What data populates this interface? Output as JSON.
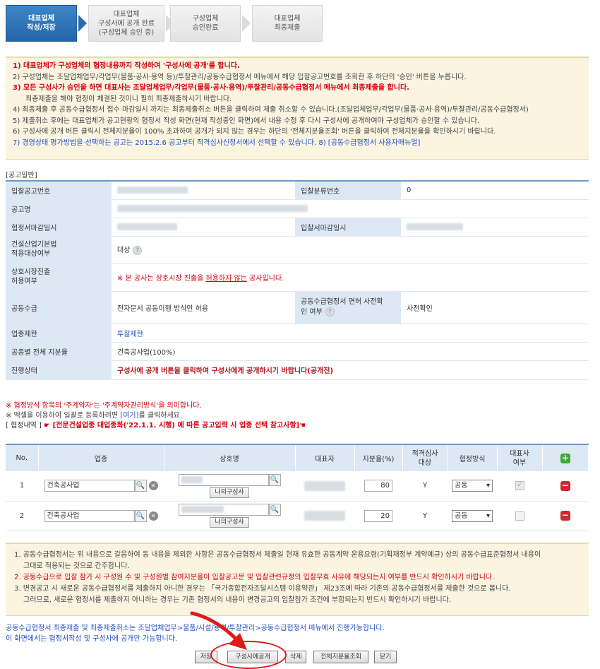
{
  "steps": [
    {
      "lines": [
        "대표업체",
        "작성/저장"
      ]
    },
    {
      "lines": [
        "대표업체",
        "구성사에 공개 완료",
        "(구성업체 승인 중)"
      ]
    },
    {
      "lines": [
        "구성업체",
        "승인완료"
      ]
    },
    {
      "lines": [
        "대표업체",
        "최종제출"
      ]
    }
  ],
  "notice": {
    "l1": "1) 대표업체가 구성업체의 협정내용까지 작성하여 '구성사에 공개'를 합니다.",
    "l2": "2) 구성업체는 조달업체업무/각업무(물품·공사·용역 등)/투찰관리/공동수급협정서 메뉴에서 해당 입찰공고번호를 조회한 후 하단의 '승인' 버튼을 누릅니다.",
    "l3": "3) 모든 구성사가 승인을 하면 대표사는 조달업체업무/각업무(물품·공사·용역)/투찰관리/공동수급협정서 메뉴에서 최종제출을 합니다.",
    "l3b": "최종제출을 해야 협정이 체결된 것이니 필히 최종제출하시기 바랍니다.",
    "l4": "4) 최종제출 후 공동수급협정서 접수 마감일시 까지는 최종제출취소 버튼을 클릭하여 제출 취소할 수 있습니다.(조달업체업무/각업무(물품·공사·용역)/투찰관리/공동수급협정서)",
    "l5": "5) 제출취소 후에는 대표업체가 공고현황의 협정서 작성 화면(현재 작성중인 화면)에서 내용 수정 후 다시 구성사에 공개하여야 구성업체가 승인할 수 있습니다.",
    "l6": "6) 구성사에 공개 버튼 클릭시 전체지분율이 100% 초과하여 공개가 되지 않는 경우는 하단의 '전체지분율조회' 버튼을 클릭하여 전체지분율을 확인하시기 바랍니다.",
    "l7": "7) 경영상태 평가방법을 선택하는 공고는 2015.2.6 공고부터 적격심사신청서에서 선택할 수 있습니다. 8)",
    "l7_link": "[공동수급협정서 사용자매뉴얼]"
  },
  "section_title": "[공고일반]",
  "info": {
    "bid_no_label": "입찰공고번호",
    "bid_class_label": "입찰분류번호",
    "bid_class_value": "0",
    "notice_name_label": "공고명",
    "deadline_label": "협정서마감일시",
    "bid_deadline_label": "입찰서마감일시",
    "construction_law_label_1": "건설산업기본법",
    "construction_law_label_2": "적용대상여부",
    "construction_law_value": "대상",
    "mutual_label_1": "상호시장진출",
    "mutual_label_2": "허용여부",
    "mutual_prefix": "※ 본 공사는 상호시장 진출을 ",
    "mutual_link": "허용하지 않는",
    "mutual_suffix": " 공사입니다.",
    "joint_label": "공동수급",
    "joint_value": "전자문서 공동이행 방식만 허용",
    "joint_exempt_label_1": "공동수급협정서 면허 사전확",
    "joint_exempt_label_2": "인 여부",
    "joint_exempt_value": "사전확인",
    "restrict_label": "업종제한",
    "restrict_value": "투찰제한",
    "share_label": "공종별 전체 지분율",
    "share_value": "건축공사업(100%)",
    "status_label": "진행상태",
    "status_value": "구성사에 공개 버튼을 클릭하여 구성사에게 공개하시기 바랍니다(공개전)"
  },
  "notes2": {
    "l1": "※ 협정방식 항목의 '주계약자'는 '주계약자관리방식'을 의미합니다.",
    "l2_prefix": "※ 엑셀을 이용하여 일괄로 등록하려면 ",
    "l2_link": "[여기]",
    "l2_suffix": "를 클릭하세요.",
    "l3_prefix": "[ 협정내역 ]",
    "l3_red": "☛ [전문건설업종 대업종화('22.1.1. 시행) 에 따른 공고입력 시 업종 선택 참고사항]☚"
  },
  "partners": {
    "headers": [
      "No.",
      "업종",
      "상호명",
      "대표자",
      "지분율(%)",
      "적격심사\n대상",
      "협정방식",
      "대표사\n여부"
    ],
    "my_company_label": "나의구성사",
    "rows": [
      {
        "no": "1",
        "industry": "건축공사업",
        "share": "80",
        "eligible": "Y",
        "method": "공동"
      },
      {
        "no": "2",
        "industry": "건축공사업",
        "share": "20",
        "eligible": "Y",
        "method": "공동"
      }
    ]
  },
  "notice2": {
    "l1": "1. 공동수급협정서는 위 내용으로 갈음하여 동 내용을 제외한 사항은 공동수급협정서 제출일 현재 유효한 공동계약 운용요령(기획재정부 계약예규) 상의 공동수급표준협정서 내용이",
    "l1b": "그대로 적용되는 것으로 간주합니다.",
    "l2": "2. 공동수급으로 입찰 참가 시 구성원 수 및 구성원별 참여지분율이 입찰공고문 및 입찰관련규정의 입찰무효 사유에 해당되는지 여부를 반드시 확인하시기 바랍니다.",
    "l3": "3. 변경공고 시 새로운 공동수급협정서를 제출하지 아니한 경우는 「국가종합전자조달시스템 이용약관」 제23조에 따라 기존의 공동수급협정서를 제출한 것으로 봅니다.",
    "l3b": "그러므로, 새로운 협정서를 제출하지 아니하는 경우는 기존 협정서의 내용이 변경공고의 입찰참가 조건에 부합되는지 반드시 확인하시기 바랍니다."
  },
  "footer": {
    "l1": "공동수급협정서 최종제출 및 최종제출취소는 조달업체업무>물품/시설/용역/투찰관리>공동수급협정서 메뉴에서 진행가능합니다.",
    "l2": "이 화면에서는 협정서작성 및 구성사에 공개만 가능합니다."
  },
  "buttons": {
    "save": "저장",
    "publish": "구성사에공개",
    "delete": "삭제",
    "total_share": "전체지분율조회",
    "close": "닫기"
  }
}
